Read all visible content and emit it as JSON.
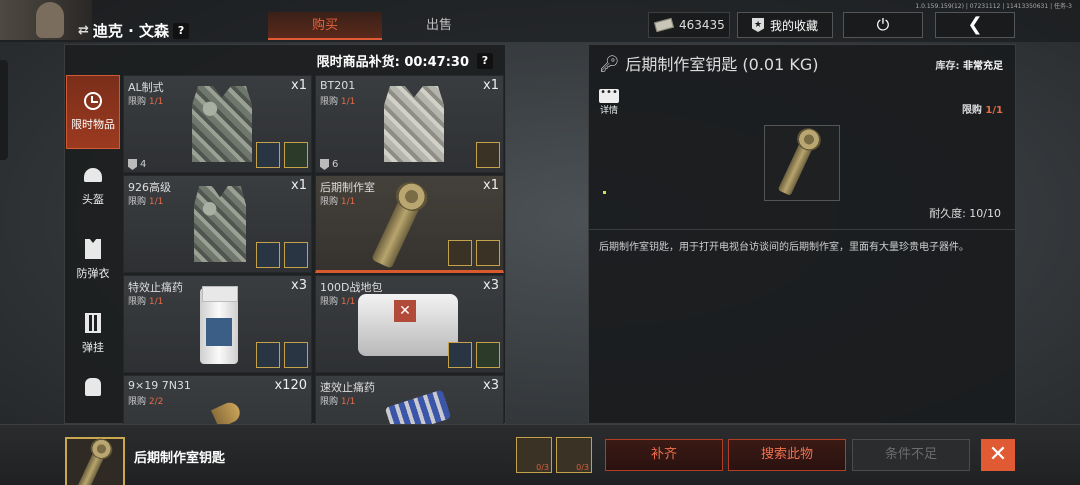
{
  "player": {
    "name": "迪克 · 文森",
    "swap_icon": "⇄",
    "help": "?"
  },
  "tabs": [
    {
      "label": "购买",
      "active": true
    },
    {
      "label": "出售",
      "active": false
    }
  ],
  "currency": {
    "amount": "463435"
  },
  "header_buttons": {
    "favorites": "我的收藏",
    "power_icon": "⏻",
    "back_icon": "❮"
  },
  "version": "1.0.159.159(12) | 07231112 | 11413350631 | 任务-3",
  "restock": {
    "label": "限时商品补货: 00:47:30",
    "help": "?"
  },
  "side_tabs": [
    {
      "label": "限时物品",
      "icon": "clock-icon",
      "active": true
    },
    {
      "label": "头盔",
      "icon": "helmet-icon"
    },
    {
      "label": "防弹衣",
      "icon": "vest-icon"
    },
    {
      "label": "弹挂",
      "icon": "chest-rig-icon"
    },
    {
      "label": "",
      "icon": "backpack-icon"
    }
  ],
  "items": [
    {
      "name": "AL制式",
      "limit_label": "限购",
      "limit": "1/1",
      "qty": "x1",
      "armor": "4"
    },
    {
      "name": "BT201",
      "limit_label": "限购",
      "limit": "1/1",
      "qty": "x1",
      "armor": "6"
    },
    {
      "name": "926高级",
      "limit_label": "限购",
      "limit": "1/1",
      "qty": "x1"
    },
    {
      "name": "后期制作室",
      "limit_label": "限购",
      "limit": "1/1",
      "qty": "x1"
    },
    {
      "name": "特效止痛药",
      "limit_label": "限购",
      "limit": "1/1",
      "qty": "x3"
    },
    {
      "name": "100D战地包",
      "limit_label": "限购",
      "limit": "1/1",
      "qty": "x3"
    },
    {
      "name": "9×19 7N31",
      "limit_label": "限购",
      "limit": "2/2",
      "qty": "x120"
    },
    {
      "name": "速效止痛药",
      "limit_label": "限购",
      "limit": "1/1",
      "qty": "x3"
    }
  ],
  "detail": {
    "title": "后期制作室钥匙 (0.01 KG)",
    "stock_label": "库存:",
    "stock_value": "非常充足",
    "detail_label": "详情",
    "limit_label": "限购",
    "limit_value": "1/1",
    "durability": "耐久度: 10/10",
    "description": "后期制作室钥匙，用于打开电视台访谈间的后期制作室，里面有大量珍贵电子器件。"
  },
  "bottom": {
    "item_name": "后期制作室钥匙",
    "req1_count": "0/3",
    "req2_count": "0/3",
    "btn_fill": "补齐",
    "btn_search": "搜索此物",
    "btn_unmet": "条件不足",
    "close_icon": "✕"
  },
  "colors": {
    "accent": "#e05a33",
    "limit": "#e56a45"
  }
}
